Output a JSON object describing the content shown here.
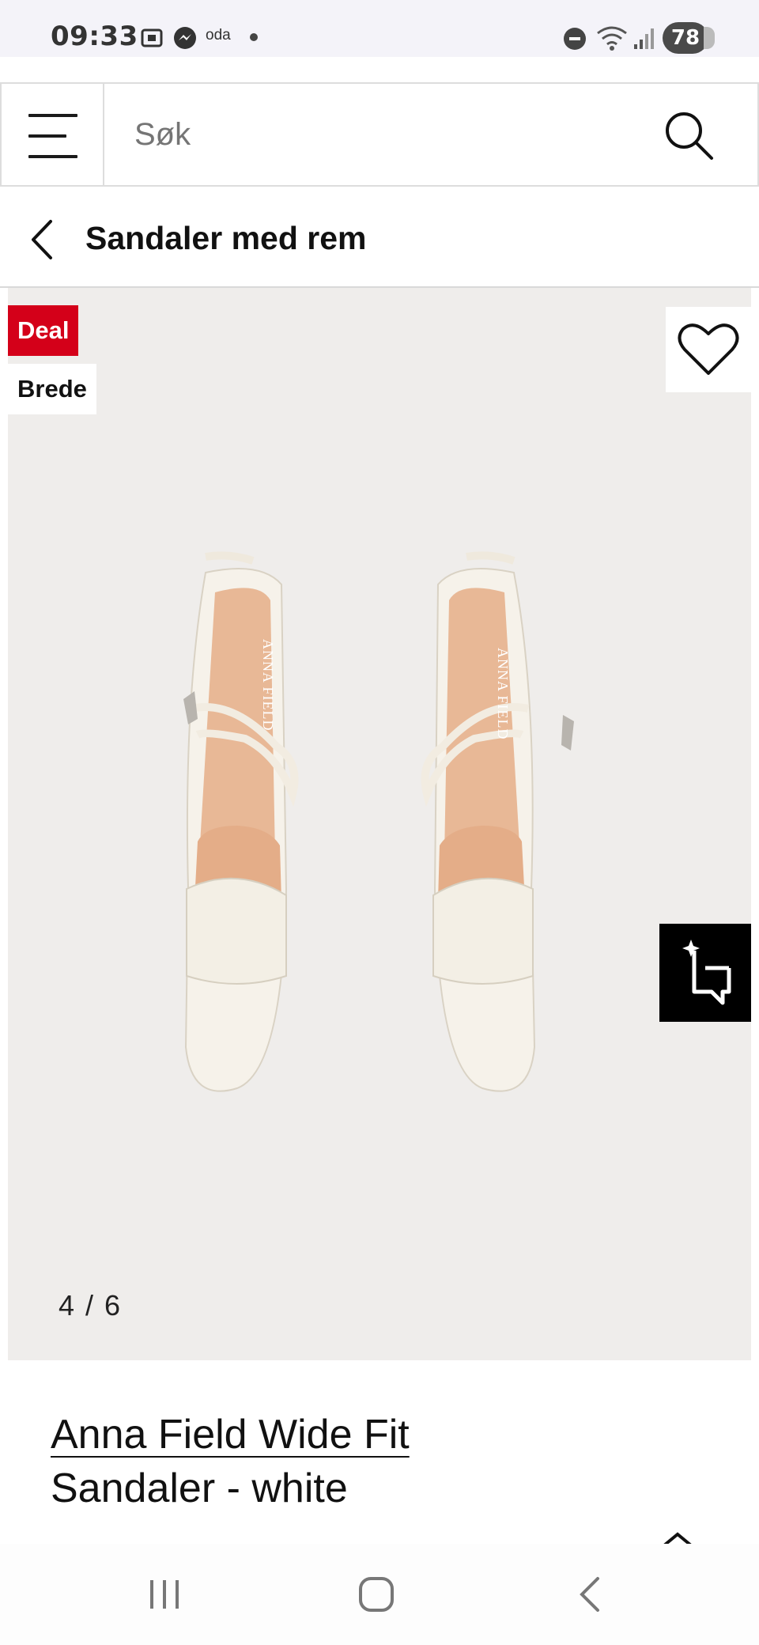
{
  "status": {
    "time": "09:33",
    "app_label": "oda",
    "battery": "78",
    "icons": [
      "screenshot-icon",
      "messenger-icon",
      "dnd-icon",
      "wifi-icon",
      "signal-icon"
    ]
  },
  "header": {
    "search_placeholder": "Søk",
    "icons": [
      "menu-icon",
      "search-icon"
    ]
  },
  "breadcrumb": {
    "title": "Sandaler med rem"
  },
  "gallery": {
    "badges": [
      "Deal",
      "Brede"
    ],
    "counter": "4 / 6",
    "image_label": "ANNA FIELD",
    "colors": {
      "deal": "#d40019",
      "background": "#efedeb"
    }
  },
  "product": {
    "brand_line": "Anna Field Wide Fit",
    "name_line": "Sandaler - white"
  },
  "navbar": {
    "icons": [
      "recent-apps-icon",
      "home-icon",
      "back-icon"
    ]
  }
}
